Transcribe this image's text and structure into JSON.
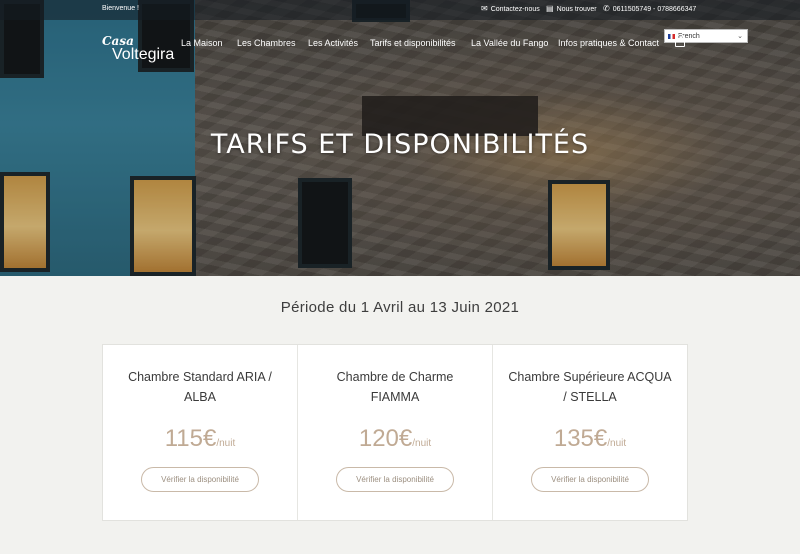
{
  "topbar": {
    "welcome": "Bienvenue !",
    "contact": "Contactez-nous",
    "find_us": "Nous trouver",
    "phones": "0611505749 - 0788666347"
  },
  "logo": {
    "line1": "Casa",
    "line2": "Voltegira"
  },
  "nav": {
    "items": [
      {
        "label": "La Maison"
      },
      {
        "label": "Les Chambres"
      },
      {
        "label": "Les Activités"
      },
      {
        "label": "Tarifs et disponibilités"
      },
      {
        "label": "La Vallée du Fango"
      },
      {
        "label": "Infos pratiques & Contact"
      }
    ]
  },
  "language": {
    "selected": "French"
  },
  "hero": {
    "title": "TARIFS ET DISPONIBILITÉS"
  },
  "period": "Période du 1 Avril au 13 Juin 2021",
  "rooms": [
    {
      "title": "Chambre Standard ARIA / ALBA",
      "price": "115€",
      "unit": "/nuit",
      "button": "Vérifier la disponibilité"
    },
    {
      "title": "Chambre de Charme FIAMMA",
      "price": "120€",
      "unit": "/nuit",
      "button": "Vérifier la disponibilité"
    },
    {
      "title": "Chambre Supérieure ACQUA / STELLA",
      "price": "135€",
      "unit": "/nuit",
      "button": "Vérifier la disponibilité"
    }
  ],
  "colors": {
    "accent": "#c0aa94",
    "background": "#f2f2ef"
  },
  "icons": [
    "mail-icon",
    "map-icon",
    "phone-icon",
    "cart-icon",
    "flag-icon",
    "chevron-down-icon"
  ]
}
